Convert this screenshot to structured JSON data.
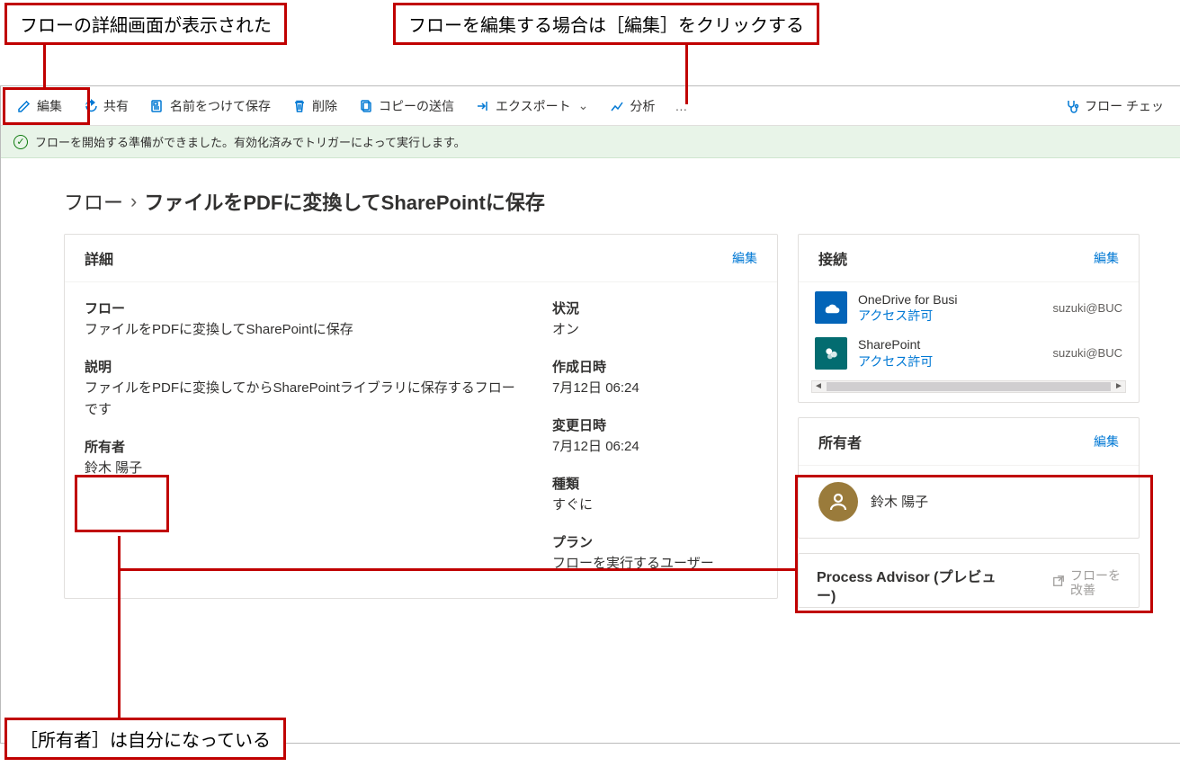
{
  "annotations": {
    "callout_top_left": "フローの詳細画面が表示された",
    "callout_top_right": "フローを編集する場合は［編集］をクリックする",
    "callout_bottom": "［所有者］は自分になっている"
  },
  "toolbar": {
    "edit": "編集",
    "share": "共有",
    "saveas": "名前をつけて保存",
    "delete": "削除",
    "sendcopy": "コピーの送信",
    "export": "エクスポート",
    "analytics": "分析",
    "more": "…",
    "flowcheck": "フロー チェッ"
  },
  "status": {
    "text": "フローを開始する準備ができました。有効化済みでトリガーによって実行します。"
  },
  "breadcrumb": {
    "root": "フロー",
    "sep": "›",
    "current": "ファイルをPDFに変換してSharePointに保存"
  },
  "detailsCard": {
    "title": "詳細",
    "edit": "編集",
    "flow_label": "フロー",
    "flow_value": "ファイルをPDFに変換してSharePointに保存",
    "desc_label": "説明",
    "desc_value": "ファイルをPDFに変換してからSharePointライブラリに保存するフローです",
    "owner_label": "所有者",
    "owner_value": "鈴木 陽子",
    "status_label": "状況",
    "status_value": "オン",
    "created_label": "作成日時",
    "created_value": "7月12日 06:24",
    "modified_label": "変更日時",
    "modified_value": "7月12日 06:24",
    "type_label": "種類",
    "type_value": "すぐに",
    "plan_label": "プラン",
    "plan_value": "フローを実行するユーザー"
  },
  "connectionsCard": {
    "title": "接続",
    "edit": "編集",
    "items": [
      {
        "name": "OneDrive for Busi",
        "perm": "アクセス許可",
        "account": "suzuki@BUC"
      },
      {
        "name": "SharePoint",
        "perm": "アクセス許可",
        "account": "suzuki@BUC"
      }
    ]
  },
  "ownersCard": {
    "title": "所有者",
    "edit": "編集",
    "owner": "鈴木 陽子"
  },
  "processAdvisorCard": {
    "title": "Process Advisor (プレビュー)",
    "action_line1": "フローを",
    "action_line2": "改善"
  }
}
